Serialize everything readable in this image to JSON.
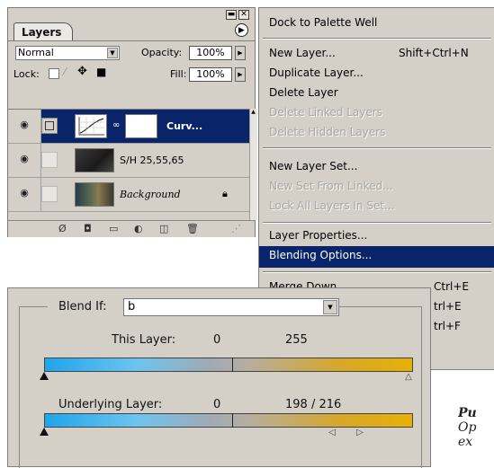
{
  "layers_panel": {
    "tab_label": "Layers",
    "blend_mode": "Normal",
    "opacity_label": "Opacity:",
    "opacity_value": "100%",
    "lock_label": "Lock:",
    "fill_label": "Fill:",
    "fill_value": "100%",
    "layers": [
      {
        "name": "Curv...",
        "icon": "curves-adjustment-icon",
        "selected": true
      },
      {
        "name": "S/H 25,55,65",
        "icon": "photo-thumbnail",
        "selected": false
      },
      {
        "name": "Background",
        "icon": "photo-thumbnail",
        "selected": false,
        "locked": true
      }
    ]
  },
  "context_menu": {
    "items": [
      {
        "label": "Dock to Palette Well",
        "shortcut": "",
        "state": "enabled"
      },
      {
        "label": "New Layer...",
        "shortcut": "Shift+Ctrl+N",
        "state": "enabled"
      },
      {
        "label": "Duplicate Layer...",
        "shortcut": "",
        "state": "enabled"
      },
      {
        "label": "Delete Layer",
        "shortcut": "",
        "state": "enabled"
      },
      {
        "label": "Delete Linked Layers",
        "shortcut": "",
        "state": "disabled"
      },
      {
        "label": "Delete Hidden Layers",
        "shortcut": "",
        "state": "disabled"
      },
      {
        "label": "New Layer Set...",
        "shortcut": "",
        "state": "enabled"
      },
      {
        "label": "New Set From Linked...",
        "shortcut": "",
        "state": "disabled"
      },
      {
        "label": "Lock All Layers In Set...",
        "shortcut": "",
        "state": "disabled"
      },
      {
        "label": "Layer Properties...",
        "shortcut": "",
        "state": "enabled"
      },
      {
        "label": "Blending Options...",
        "shortcut": "",
        "state": "selected"
      },
      {
        "label": "Merge Down",
        "shortcut": "Ctrl+E",
        "state": "enabled"
      },
      {
        "label": "",
        "shortcut": "trl+E",
        "state": "enabled"
      },
      {
        "label": "",
        "shortcut": "trl+F",
        "state": "enabled"
      }
    ]
  },
  "blend_if": {
    "label": "Blend If:",
    "channel": "b",
    "this_layer_label": "This Layer:",
    "this_layer_black": "0",
    "this_layer_white": "255",
    "underlying_label": "Underlying Layer:",
    "underlying_black": "0",
    "underlying_white": "198 / 216"
  },
  "side_text": {
    "line1": "Pu",
    "line2": "Op",
    "line3": "ex"
  },
  "colors": {
    "panel_bg": "#d4d0c8",
    "selection": "#0a246a",
    "bar_blue": "#1fa5ea",
    "bar_gold": "#e8b006"
  }
}
